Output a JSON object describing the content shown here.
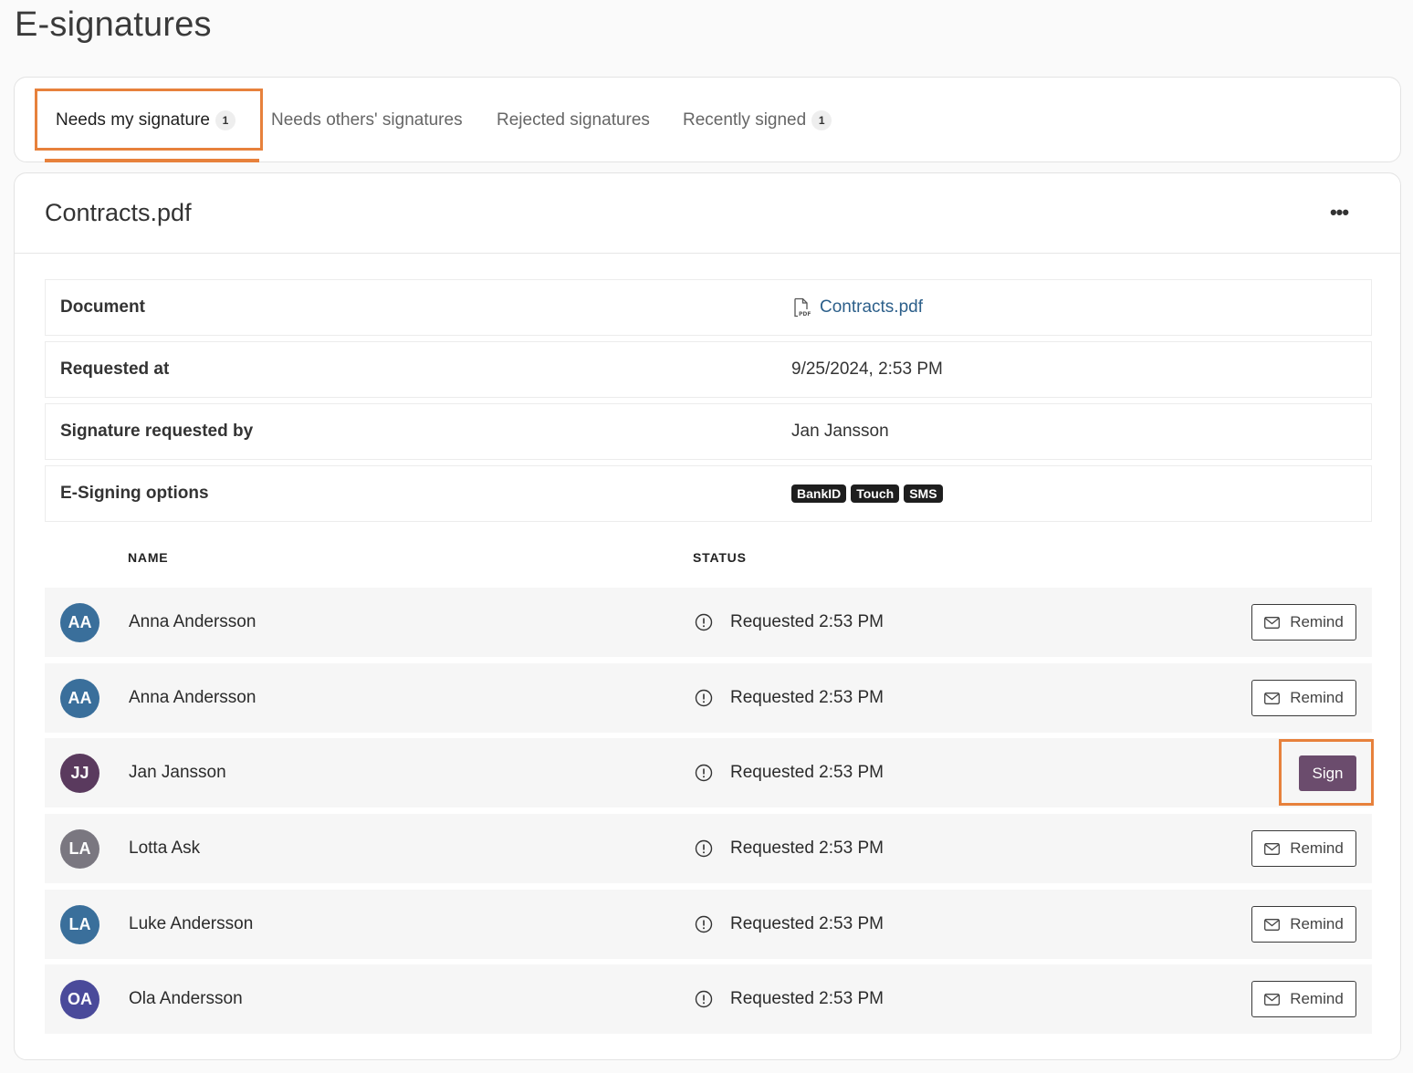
{
  "page": {
    "title": "E-signatures"
  },
  "tabs": [
    {
      "label": "Needs my signature",
      "count": "1"
    },
    {
      "label": "Needs others' signatures",
      "count": ""
    },
    {
      "label": "Rejected signatures",
      "count": ""
    },
    {
      "label": "Recently signed",
      "count": "1"
    }
  ],
  "colors": {
    "highlight": "#e7813c",
    "sign_button": "#6b4c6d",
    "link": "#2c5f8a"
  },
  "document": {
    "title": "Contracts.pdf",
    "more_label": "•••",
    "details": {
      "document_label": "Document",
      "document_value": "Contracts.pdf",
      "document_icon": "pdf-file-icon",
      "requested_at_label": "Requested at",
      "requested_at_value": "9/25/2024, 2:53 PM",
      "requested_by_label": "Signature requested by",
      "requested_by_value": "Jan Jansson",
      "options_label": "E-Signing options",
      "options": [
        "BankID",
        "Touch",
        "SMS"
      ]
    },
    "table": {
      "name_header": "NAME",
      "status_header": "STATUS",
      "rows": [
        {
          "initials": "AA",
          "name": "Anna Andersson",
          "status": "Requested 2:53 PM",
          "action": "Remind",
          "avatar_color": "#3a6f9b"
        },
        {
          "initials": "AA",
          "name": "Anna Andersson",
          "status": "Requested 2:53 PM",
          "action": "Remind",
          "avatar_color": "#3a6f9b"
        },
        {
          "initials": "JJ",
          "name": "Jan Jansson",
          "status": "Requested 2:53 PM",
          "action": "Sign",
          "avatar_color": "#5a3a5e"
        },
        {
          "initials": "LA",
          "name": "Lotta Ask",
          "status": "Requested 2:53 PM",
          "action": "Remind",
          "avatar_color": "#7a7780"
        },
        {
          "initials": "LA",
          "name": "Luke Andersson",
          "status": "Requested 2:53 PM",
          "action": "Remind",
          "avatar_color": "#3a6f9b"
        },
        {
          "initials": "OA",
          "name": "Ola Andersson",
          "status": "Requested 2:53 PM",
          "action": "Remind",
          "avatar_color": "#4a4a9a"
        }
      ]
    }
  }
}
